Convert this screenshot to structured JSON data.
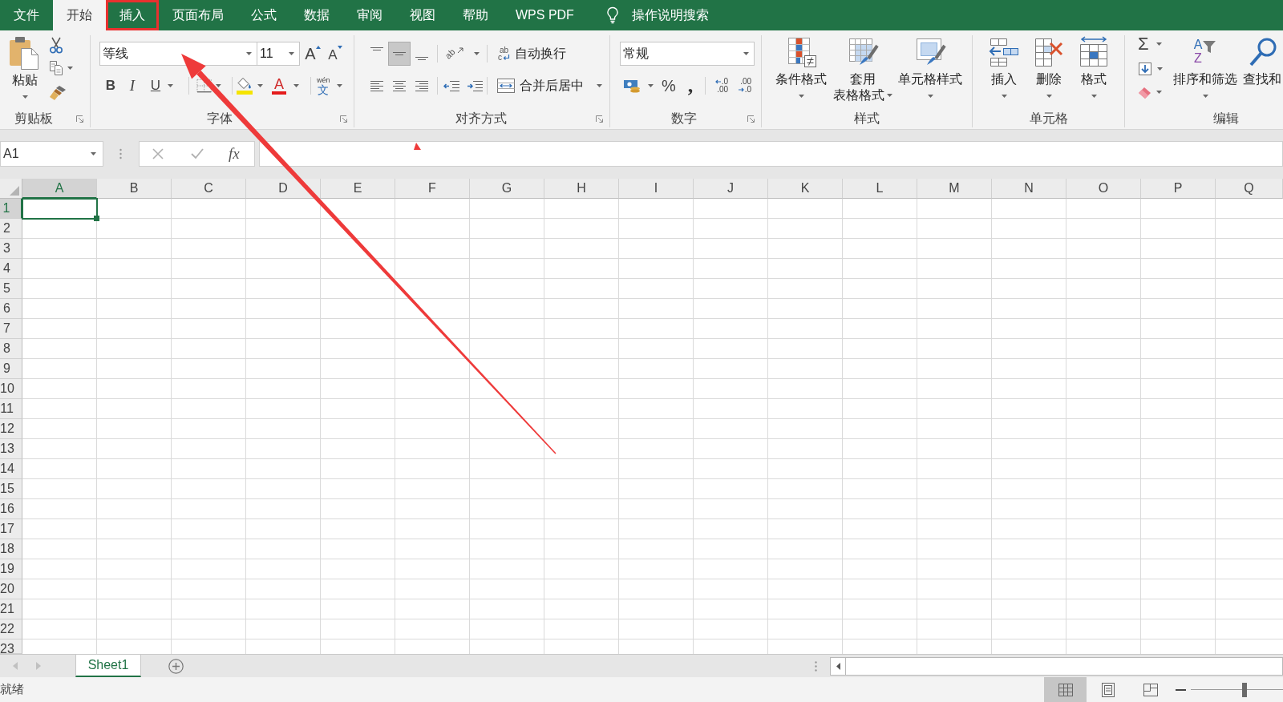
{
  "menu_tabs": [
    {
      "label": "文件",
      "selected": false,
      "highlighted": false
    },
    {
      "label": "开始",
      "selected": true,
      "highlighted": false
    },
    {
      "label": "插入",
      "selected": false,
      "highlighted": true
    },
    {
      "label": "页面布局",
      "selected": false,
      "highlighted": false
    },
    {
      "label": "公式",
      "selected": false,
      "highlighted": false
    },
    {
      "label": "数据",
      "selected": false,
      "highlighted": false
    },
    {
      "label": "审阅",
      "selected": false,
      "highlighted": false
    },
    {
      "label": "视图",
      "selected": false,
      "highlighted": false
    },
    {
      "label": "帮助",
      "selected": false,
      "highlighted": false
    },
    {
      "label": "WPS PDF",
      "selected": false,
      "highlighted": false
    }
  ],
  "tell_me": {
    "label": "操作说明搜索"
  },
  "ribbon": {
    "clipboard": {
      "title": "剪贴板",
      "paste": "粘贴"
    },
    "font": {
      "title": "字体",
      "font_name": "等线",
      "font_size": "11",
      "grow": "A",
      "shrink": "A",
      "bold": "B",
      "italic": "I",
      "underline": "U",
      "font_color": "A",
      "phonetic": {
        "pinyin": "wén",
        "character": "文"
      }
    },
    "alignment": {
      "title": "对齐方式",
      "vertical": [
        {
          "kind": "top",
          "selected": false
        },
        {
          "kind": "middle",
          "selected": true
        },
        {
          "kind": "bottom",
          "selected": false
        }
      ],
      "orientation": "ab",
      "horizontal": [
        {
          "kind": "left",
          "selected": false
        },
        {
          "kind": "center",
          "selected": false
        },
        {
          "kind": "right",
          "selected": false
        }
      ],
      "indent": [
        {
          "kind": "decrease"
        },
        {
          "kind": "increase"
        }
      ],
      "wrap_text": {
        "icon_top": "ab",
        "icon_bottom": "c",
        "label": "自动换行"
      },
      "merge": "合并后居中"
    },
    "number": {
      "title": "数字",
      "format": "常规",
      "percent": "%",
      "comma": ",",
      "decimals": [
        {
          "kind": "increase",
          "top": ".0",
          "bottom": ".00"
        },
        {
          "kind": "decrease",
          "top": ".00",
          "bottom": ".0"
        }
      ]
    },
    "styles": {
      "title": "样式",
      "buttons": [
        {
          "kind": "conditional",
          "lines": [
            "条件格式"
          ]
        },
        {
          "kind": "table",
          "lines": [
            "套用",
            "表格格式"
          ]
        },
        {
          "kind": "cell_style",
          "lines": [
            "单元格样式"
          ]
        }
      ]
    },
    "cells": {
      "title": "单元格",
      "buttons": [
        {
          "kind": "insert",
          "label": "插入"
        },
        {
          "kind": "delete",
          "label": "删除"
        },
        {
          "kind": "format",
          "label": "格式"
        }
      ]
    },
    "editing": {
      "title": "编辑",
      "autosum": "Σ",
      "sort": {
        "letters": [
          "A",
          "Z"
        ],
        "label": "排序和筛选"
      },
      "find": "查找和"
    }
  },
  "formula_bar": {
    "name_box": "A1",
    "function_symbol": "fx"
  },
  "sheet": {
    "columns": [
      {
        "label": "A",
        "selected": true
      },
      {
        "label": "B",
        "selected": false
      },
      {
        "label": "C",
        "selected": false
      },
      {
        "label": "D",
        "selected": false
      },
      {
        "label": "E",
        "selected": false
      },
      {
        "label": "F",
        "selected": false
      },
      {
        "label": "G",
        "selected": false
      },
      {
        "label": "H",
        "selected": false
      },
      {
        "label": "I",
        "selected": false
      },
      {
        "label": "J",
        "selected": false
      },
      {
        "label": "K",
        "selected": false
      },
      {
        "label": "L",
        "selected": false
      },
      {
        "label": "M",
        "selected": false
      },
      {
        "label": "N",
        "selected": false
      },
      {
        "label": "O",
        "selected": false
      },
      {
        "label": "P",
        "selected": false
      },
      {
        "label": "Q",
        "selected": false
      }
    ],
    "rows": [
      {
        "label": "1",
        "selected": true
      },
      {
        "label": "2",
        "selected": false
      },
      {
        "label": "3",
        "selected": false
      },
      {
        "label": "4",
        "selected": false
      },
      {
        "label": "5",
        "selected": false
      },
      {
        "label": "6",
        "selected": false
      },
      {
        "label": "7",
        "selected": false
      },
      {
        "label": "8",
        "selected": false
      },
      {
        "label": "9",
        "selected": false
      },
      {
        "label": "10",
        "selected": false
      },
      {
        "label": "11",
        "selected": false
      },
      {
        "label": "12",
        "selected": false
      },
      {
        "label": "13",
        "selected": false
      },
      {
        "label": "14",
        "selected": false
      },
      {
        "label": "15",
        "selected": false
      },
      {
        "label": "16",
        "selected": false
      },
      {
        "label": "17",
        "selected": false
      },
      {
        "label": "18",
        "selected": false
      },
      {
        "label": "19",
        "selected": false
      },
      {
        "label": "20",
        "selected": false
      },
      {
        "label": "21",
        "selected": false
      },
      {
        "label": "22",
        "selected": false
      },
      {
        "label": "23",
        "selected": false
      }
    ]
  },
  "sheet_tabs": [
    {
      "label": "Sheet1",
      "selected": true
    }
  ],
  "status_bar": {
    "status": "就绪",
    "views": [
      {
        "kind": "normal",
        "selected": true
      },
      {
        "kind": "page_layout",
        "selected": false
      },
      {
        "kind": "page_break",
        "selected": false
      }
    ],
    "zoom": {
      "level": 0.58
    }
  }
}
